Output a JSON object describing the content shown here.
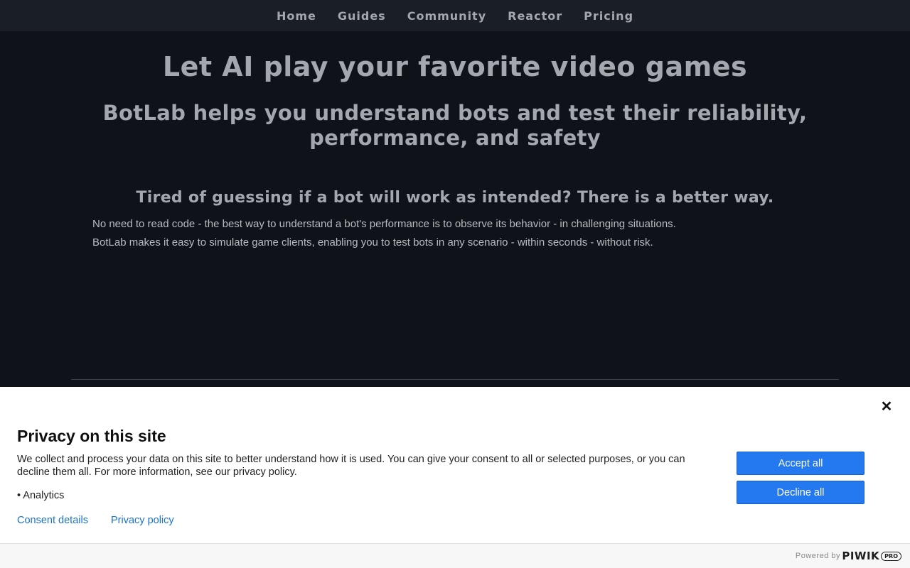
{
  "nav": {
    "items": [
      {
        "label": "Home"
      },
      {
        "label": "Guides"
      },
      {
        "label": "Community"
      },
      {
        "label": "Reactor"
      },
      {
        "label": "Pricing"
      }
    ]
  },
  "hero": {
    "headline": "Let AI play your favorite video games",
    "subheadline": "BotLab helps you understand bots and test their reliability, performance, and safety",
    "section_title": "Tired of guessing if a bot will work as intended? There is a better way.",
    "paragraph_1": "No need to read code - the best way to understand a bot's performance is to observe its behavior - in challenging situations.",
    "paragraph_2": "BotLab makes it easy to simulate game clients, enabling you to test bots in any scenario - within seconds - without risk."
  },
  "consent": {
    "title": "Privacy on this site",
    "text": "We collect and process your data on this site to better understand how it is used. You can give your consent to all or selected purposes, or you can decline them all. For more information, see our privacy policy.",
    "purpose": "• Analytics",
    "consent_details_label": "Consent details",
    "privacy_policy_label": "Privacy policy",
    "accept_label": "Accept all",
    "decline_label": "Decline all",
    "close_glyph": "✕",
    "powered_by": "Powered by",
    "brand_word": "PIWIK",
    "brand_badge": "PRO"
  },
  "colors": {
    "page_bg": "#0f1218",
    "nav_bg": "#1a1e26",
    "text_muted": "#a4a8ae",
    "button_blue": "#2478f0",
    "link_blue": "#1a73c9"
  }
}
